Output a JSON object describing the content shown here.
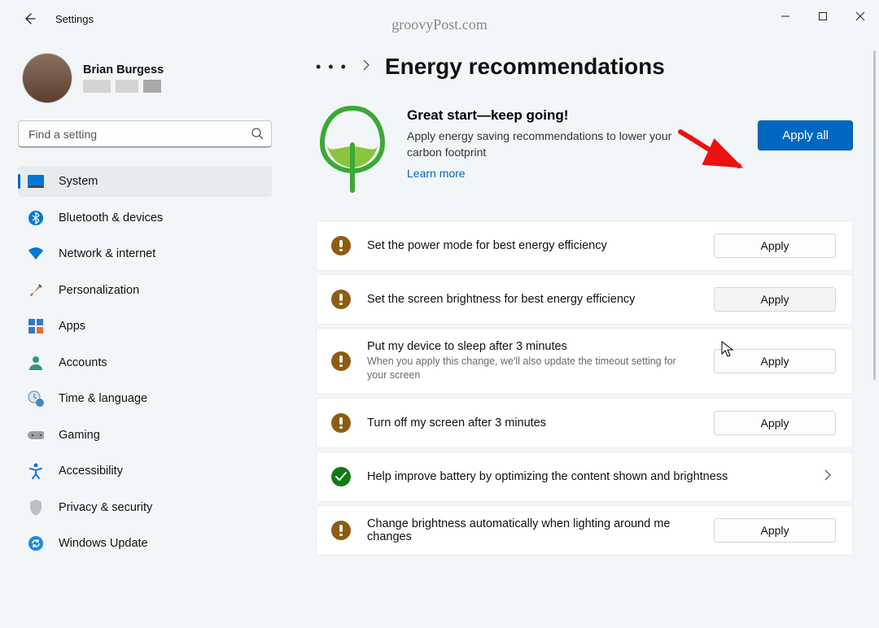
{
  "titlebar": {
    "app_title": "Settings",
    "watermark": "groovyPost.com"
  },
  "user": {
    "name": "Brian Burgess"
  },
  "search": {
    "placeholder": "Find a setting"
  },
  "nav": [
    {
      "label": "System",
      "active": true
    },
    {
      "label": "Bluetooth & devices"
    },
    {
      "label": "Network & internet"
    },
    {
      "label": "Personalization"
    },
    {
      "label": "Apps"
    },
    {
      "label": "Accounts"
    },
    {
      "label": "Time & language"
    },
    {
      "label": "Gaming"
    },
    {
      "label": "Accessibility"
    },
    {
      "label": "Privacy & security"
    },
    {
      "label": "Windows Update"
    }
  ],
  "page": {
    "title": "Energy recommendations",
    "hero_title": "Great start—keep going!",
    "hero_sub": "Apply energy saving recommendations to lower your carbon footprint",
    "hero_link": "Learn more",
    "apply_all": "Apply all"
  },
  "cards": [
    {
      "title": "Set the power mode for best energy efficiency",
      "status": "warn",
      "btn": "Apply"
    },
    {
      "title": "Set the screen brightness for best energy efficiency",
      "status": "warn",
      "btn": "Apply",
      "hover": true
    },
    {
      "title": "Put my device to sleep after 3 minutes",
      "sub": "When you apply this change, we'll also update the timeout setting for your screen",
      "status": "warn",
      "btn": "Apply"
    },
    {
      "title": "Turn off my screen after 3 minutes",
      "status": "warn",
      "btn": "Apply"
    },
    {
      "title": "Help improve battery by optimizing the content shown and brightness",
      "status": "ok",
      "chevron": true
    },
    {
      "title": "Change brightness automatically when lighting around me changes",
      "status": "warn",
      "btn": "Apply"
    }
  ]
}
